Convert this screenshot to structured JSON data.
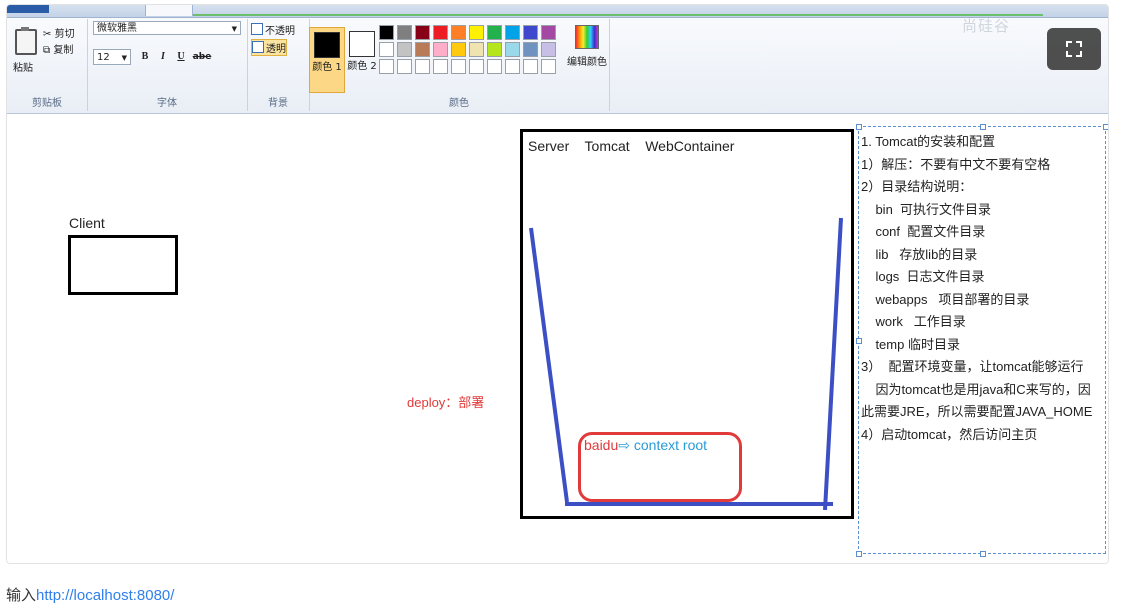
{
  "ribbon": {
    "watermark": "尚硅谷",
    "clipboard": {
      "paste": "粘贴",
      "cut": "剪切",
      "copy": "复制",
      "group_label": "剪贴板"
    },
    "font": {
      "family": "微软雅黑",
      "size": "12",
      "bold": "B",
      "italic": "I",
      "underline": "U",
      "strike": "abe",
      "group_label": "字体"
    },
    "background": {
      "opaque": "不透明",
      "transparent": "透明",
      "group_label": "背景"
    },
    "colors": {
      "color1_label": "颜色 1",
      "color2_label": "颜色 2",
      "color1": "#000000",
      "color2": "#ffffff",
      "edit_colors": "编辑颜色",
      "group_label": "颜色",
      "palette_row1": [
        "#000000",
        "#7f7f7f",
        "#880015",
        "#ed1c24",
        "#ff7f27",
        "#fff200",
        "#22b14c",
        "#00a2e8",
        "#3f48cc",
        "#a349a4"
      ],
      "palette_row2": [
        "#ffffff",
        "#c3c3c3",
        "#b97a57",
        "#ffaec9",
        "#ffc90e",
        "#efe4b0",
        "#b5e61d",
        "#99d9ea",
        "#7092be",
        "#c8bfe7"
      ]
    }
  },
  "canvas": {
    "client_label": "Client",
    "server_title": "Server    Tomcat    WebContainer",
    "deploy": "deploy：部署",
    "context_red": "baidu",
    "context_arrow": "⇨",
    "context_blue": " context root",
    "notes": [
      "1. Tomcat的安装和配置",
      "1）解压：不要有中文不要有空格",
      "2）目录结构说明：",
      "    bin  可执行文件目录",
      "    conf  配置文件目录",
      "    lib   存放lib的目录",
      "    logs  日志文件目录",
      "    webapps   项目部署的目录",
      "    work   工作目录",
      "    temp 临时目录",
      "3）  配置环境变量，让tomcat能够运行",
      "    因为tomcat也是用java和C来写的，因",
      "此需要JRE，所以需要配置JAVA_HOME",
      "4）启动tomcat，然后访问主页"
    ]
  },
  "footer": {
    "prefix": "输入",
    "link": "http://localhost:8080/"
  }
}
